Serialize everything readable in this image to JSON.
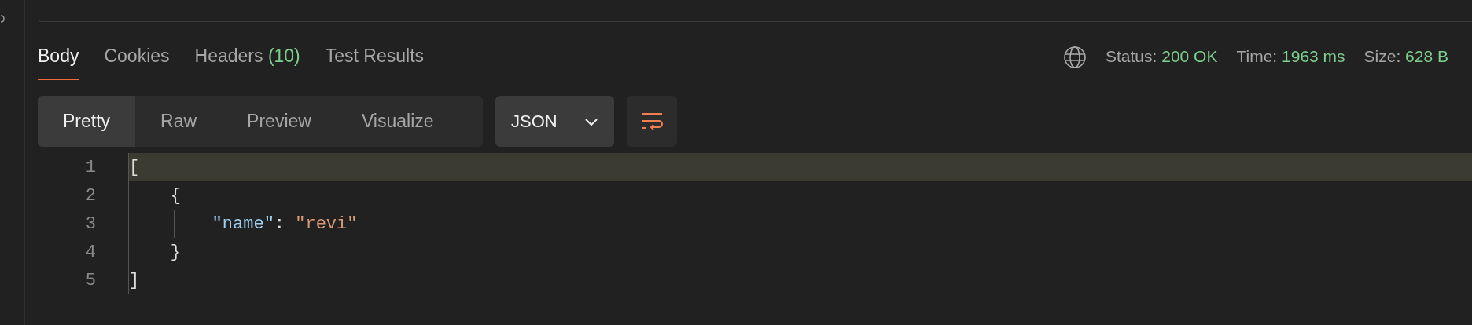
{
  "tabs": [
    {
      "label": "Body",
      "selected": true
    },
    {
      "label": "Cookies",
      "selected": false
    },
    {
      "label": "Headers",
      "count": "(10)",
      "selected": false
    },
    {
      "label": "Test Results",
      "selected": false
    }
  ],
  "status": [
    {
      "label": "Status:",
      "value": "200 OK"
    },
    {
      "label": "Time:",
      "value": "1963 ms"
    },
    {
      "label": "Size:",
      "value": "628 B"
    }
  ],
  "view_modes": [
    {
      "label": "Pretty",
      "selected": true
    },
    {
      "label": "Raw",
      "selected": false
    },
    {
      "label": "Preview",
      "selected": false
    },
    {
      "label": "Visualize",
      "selected": false
    }
  ],
  "format": {
    "label": "JSON"
  },
  "code": [
    {
      "number": "1",
      "highlighted": true,
      "tokens": [
        {
          "kind": "punct",
          "text": "["
        }
      ]
    },
    {
      "number": "2",
      "highlighted": false,
      "tokens": [
        {
          "kind": "punct",
          "text": "    {"
        }
      ]
    },
    {
      "number": "3",
      "highlighted": false,
      "tokens": [
        {
          "kind": "key",
          "text": "        \"name\""
        },
        {
          "kind": "punct",
          "text": ": "
        },
        {
          "kind": "string",
          "text": "\"revi\""
        }
      ]
    },
    {
      "number": "4",
      "highlighted": false,
      "tokens": [
        {
          "kind": "punct",
          "text": "    }"
        }
      ]
    },
    {
      "number": "5",
      "highlighted": false,
      "tokens": [
        {
          "kind": "punct",
          "text": "]"
        }
      ]
    }
  ]
}
